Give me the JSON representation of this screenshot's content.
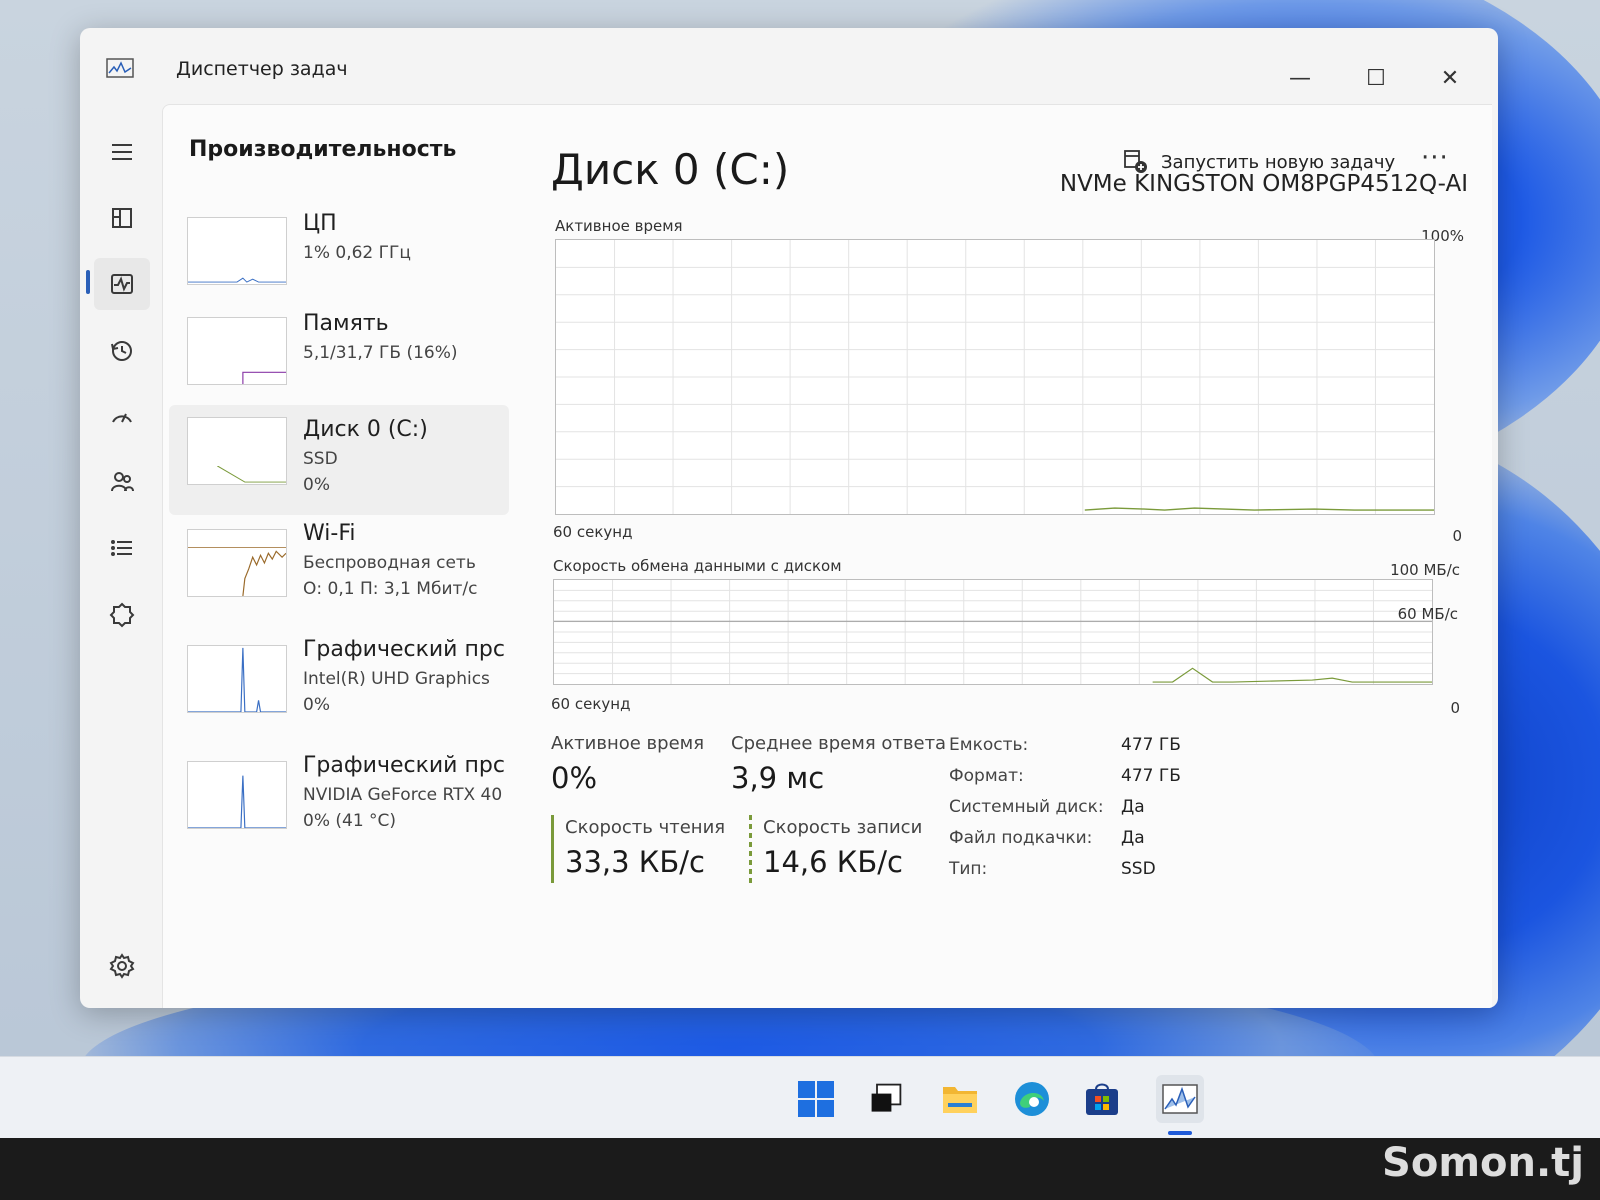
{
  "window": {
    "title": "Диспетчер задач",
    "minimize": "—",
    "maximize": "☐",
    "close": "✕"
  },
  "header": {
    "page_title": "Производительность",
    "run_task_label": "Запустить новую задачу",
    "more_label": "···"
  },
  "rail": {
    "icons": [
      "menu-icon",
      "processes-icon",
      "performance-icon",
      "app-history-icon",
      "startup-icon",
      "users-icon",
      "details-icon",
      "services-icon",
      "settings-icon"
    ]
  },
  "resources": [
    {
      "name": "ЦП",
      "line1": "1% 0,62 ГГц",
      "line2": ""
    },
    {
      "name": "Память",
      "line1": "5,1/31,7 ГБ (16%)",
      "line2": ""
    },
    {
      "name": "Диск 0 (C:)",
      "line1": "SSD",
      "line2": "0%"
    },
    {
      "name": "Wi-Fi",
      "line1": "Беспроводная сеть",
      "line2": "О: 0,1 П: 3,1 Мбит/с"
    },
    {
      "name": "Графический прс",
      "line1": "Intel(R) UHD Graphics",
      "line2": "0%"
    },
    {
      "name": "Графический прс",
      "line1": "NVIDIA GeForce RTX 40",
      "line2": "0% (41 °C)"
    }
  ],
  "detail": {
    "title": "Диск 0 (C:)",
    "model": "NVMe KINGSTON OM8PGP4512Q-AI",
    "chart1": {
      "label": "Активное время",
      "max_label": "100%",
      "time_label": "60 секунд",
      "min_label": "0"
    },
    "chart2": {
      "label": "Скорость обмена данными с диском",
      "max_label": "100 МБ/с",
      "mid_label": "60 МБ/с",
      "time_label": "60 секунд",
      "min_label": "0"
    },
    "stats": {
      "active_time_label": "Активное время",
      "active_time_value": "0%",
      "avg_response_label": "Среднее время ответа",
      "avg_response_value": "3,9 мс",
      "read_speed_label": "Скорость чтения",
      "read_speed_value": "33,3 КБ/с",
      "write_speed_label": "Скорость записи",
      "write_speed_value": "14,6 КБ/с"
    },
    "properties": [
      {
        "key": "Емкость:",
        "value": "477 ГБ"
      },
      {
        "key": "Формат:",
        "value": "477 ГБ"
      },
      {
        "key": "Системный диск:",
        "value": "Да"
      },
      {
        "key": "Файл подкачки:",
        "value": "Да"
      },
      {
        "key": "Тип:",
        "value": "SSD"
      }
    ]
  },
  "taskbar": {
    "icons": [
      "start-icon",
      "task-view-icon",
      "file-explorer-icon",
      "edge-icon",
      "store-icon",
      "task-manager-icon"
    ]
  },
  "watermark": "Somon.tj",
  "colors": {
    "accent": "#2a5fb8",
    "disk_graph": "#7a9a3a",
    "wifi_graph": "#9a6a2a"
  }
}
